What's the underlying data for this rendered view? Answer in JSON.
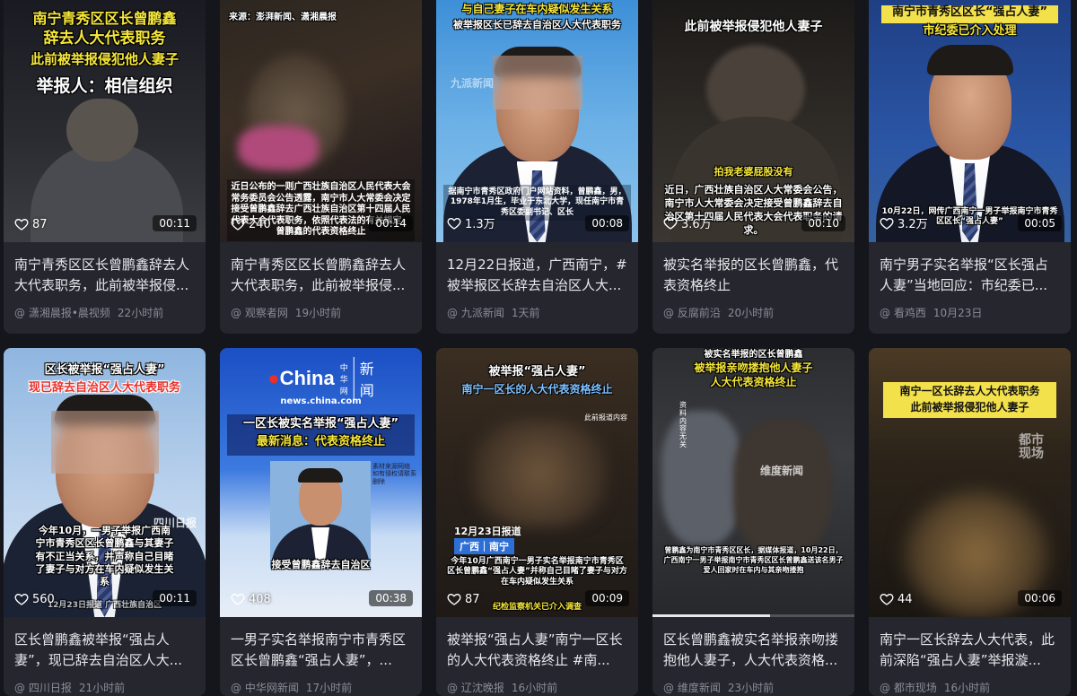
{
  "cards": [
    {
      "overlay": [
        "南宁青秀区区长曾鹏鑫",
        "辞去人大代表职务",
        "此前被举报侵犯他人妻子",
        "举报人：相信组织"
      ],
      "likes": "87",
      "duration": "00:11",
      "title": "南宁青秀区区长曾鹏鑫辞去人大代表职务，此前被举报侵...",
      "source": "潇湘晨报•晨视频",
      "time": "22小时前"
    },
    {
      "overlay_top": "来源：澎湃新闻、潇湘晨报",
      "subtitle": "近日公布的一则广西壮族自治区人民代表大会常务委员会公告透露，南宁市人大常委会决定接受曾鹏鑫辞去广西壮族自治区第十四届人民代表大会代表职务，依照代表法的有关规定，曾鹏鑫的代表资格终止",
      "likes": "240",
      "duration": "00:14",
      "title": "南宁青秀区区长曾鹏鑫辞去人大代表职务，此前被举报侵...",
      "source": "观察者网",
      "time": "19小时前"
    },
    {
      "overlay": [
        "与自己妻子在车内疑似发生关系",
        "被举报区长已辞去自治区人大代表职务"
      ],
      "watermark": "九派新闻",
      "subtitle": "据南宁市青秀区政府门户网站资料，曾鹏鑫，男，1978年1月生，毕业于东北大学，现任南宁市青秀区委副书记、区长",
      "likes": "1.3万",
      "duration": "00:08",
      "title": "12月22日报道，广西南宁，#被举报区长辞去自治区人大...",
      "source": "九派新闻",
      "time": "1天前"
    },
    {
      "overlay": [
        "此前被举报侵犯他人妻子"
      ],
      "caption": "拍我老婆屁股没有",
      "subtitle": "近日，广西壮族自治区人大常委会公告，南宁市人大常委会决定接受曾鹏鑫辞去自治区第十四届人民代表大会代表职务的请求。",
      "likes": "3.6万",
      "duration": "00:10",
      "title": "被实名举报的区长曾鹏鑫，代表资格终止",
      "source": "反腐前沿",
      "time": "20小时前"
    },
    {
      "overlay": [
        "南宁市青秀区区长“强占人妻”",
        "市纪委已介入处理"
      ],
      "subtitle": "10月22日，网传广西南宁一男子举报南宁市青秀区区长“强占人妻”",
      "likes": "3.2万",
      "duration": "00:05",
      "title": "南宁男子实名举报“区长强占人妻”当地回应：市纪委已...",
      "source": "看鸡西",
      "time": "10月23日"
    },
    {
      "overlay": [
        "区长被举报“强占人妻”",
        "现已辞去自治区人大代表职务"
      ],
      "watermark": "四川日报",
      "subtitle": "今年10月，一男子举报广西南宁市青秀区区长曾鹏鑫与其妻子有不正当关系，并声称自己目睹了妻子与对方在车内疑似发生关系",
      "footnote": "12月23日报道 广西壮族自治区",
      "likes": "560",
      "duration": "00:11",
      "title": "区长曾鹏鑫被举报“强占人妻”，现已辞去自治区人大...",
      "source": "四川日报",
      "time": "21小时前"
    },
    {
      "logo": "China",
      "logo_sub": "中华网",
      "logo_word": "新闻",
      "site": "news.china.com",
      "overlay": [
        "一区长被实名举报“强占人妻”",
        "最新消息：代表资格终止"
      ],
      "note": "素材来源网络 如有侵权请联系删除",
      "subtitle": "接受曾鹏鑫辞去自治区",
      "likes": "408",
      "duration": "00:38",
      "title": "一男子实名举报南宁市青秀区区长曾鹏鑫“强占人妻”，...",
      "source": "中华网新闻",
      "time": "17小时前"
    },
    {
      "overlay": [
        "被举报“强占人妻”",
        "南宁一区长的人大代表资格终止"
      ],
      "tag_date": "12月23日报道",
      "tag_place": "广西｜南宁",
      "small": "此前报道内容",
      "subtitle": "今年10月广西南宁一男子实名举报南宁市青秀区区长曾鹏鑫“强占人妻”并称自己目睹了妻子与对方在车内疑似发生关系",
      "sub_yellow": "纪检监察机关已介入调查",
      "likes": "87",
      "duration": "00:09",
      "title": "被举报“强占人妻”南宁一区长的人大代表资格终止 #南...",
      "source": "辽沈晚报",
      "time": "16小时前"
    },
    {
      "overlay": [
        "被实名举报的区长曾鹏鑫",
        "被举报亲吻搂抱他人妻子",
        "人大代表资格终止"
      ],
      "watermark": "维度新闻",
      "side": "资料内容无关",
      "subtitle": "曾鹏鑫为南宁市青秀区区长，据媒体报道，10月22日，广西南宁一男子举报南宁市青秀区区长曾鹏鑫送该名男子爱人回家时在车内与其亲吻搂抱",
      "likes": "",
      "progress": 0.58,
      "title": "区长曾鹏鑫被实名举报亲吻搂抱他人妻子，人大代表资格...",
      "source": "维度新闻",
      "time": "23小时前"
    },
    {
      "overlay": [
        "南宁一区长辞去人大代表职务",
        "此前被举报侵犯他人妻子"
      ],
      "watermark": "都市现场",
      "likes": "44",
      "duration": "00:06",
      "title": "南宁一区长辞去人大代表，此前深陷“强占人妻”举报漩...",
      "source": "都市现场",
      "time": "16小时前"
    }
  ]
}
